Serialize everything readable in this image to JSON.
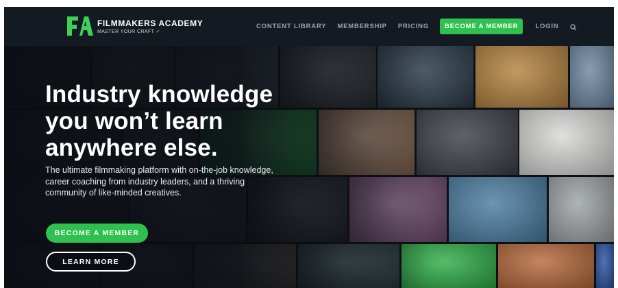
{
  "brand": {
    "name": "FILMMAKERS ACADEMY",
    "tagline": "MASTER YOUR CRAFT",
    "tagline_mark": "✓",
    "logo_mark": "FA",
    "accent_color": "#2ec14f"
  },
  "nav": {
    "items": [
      "CONTENT LIBRARY",
      "MEMBERSHIP",
      "PRICING"
    ],
    "cta": "BECOME A MEMBER",
    "login": "LOGIN",
    "search_icon": "search-icon"
  },
  "hero": {
    "title": "Industry knowledge you won’t learn anywhere else.",
    "subtitle": "The ultimate filmmaking platform with on-the-job knowledge, career coaching from industry leaders, and a thriving community of like-minded creatives.",
    "primary_button": "BECOME A MEMBER",
    "secondary_button": "LEARN MORE"
  }
}
